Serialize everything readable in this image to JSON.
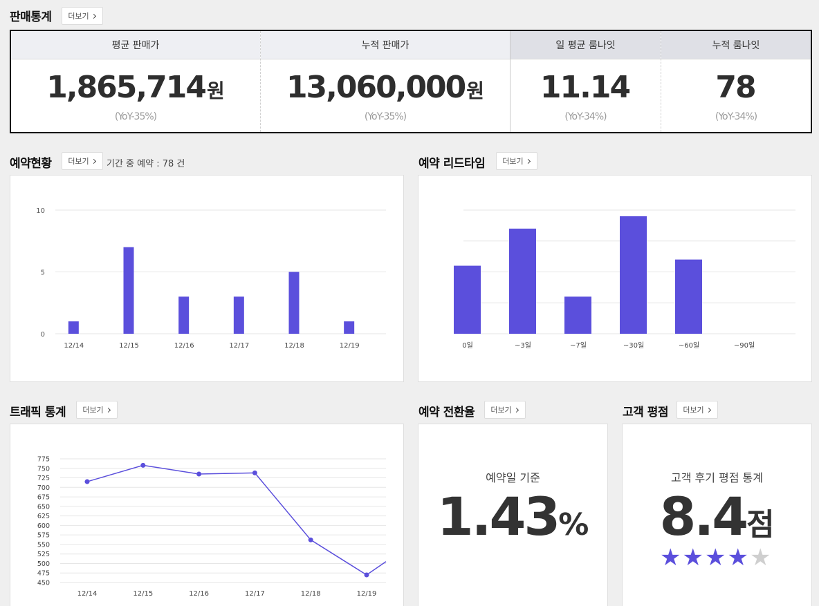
{
  "sales_stats": {
    "title": "판매통계",
    "more_label": "더보기",
    "columns": [
      {
        "label": "평균 판매가",
        "value": "1,865,714",
        "unit": "원",
        "yoy": "(YoY-35%)"
      },
      {
        "label": "누적 판매가",
        "value": "13,060,000",
        "unit": "원",
        "yoy": "(YoY-35%)"
      },
      {
        "label": "일 평균 룸나잇",
        "value": "11.14",
        "unit": "",
        "yoy": "(YoY-34%)"
      },
      {
        "label": "누적 룸나잇",
        "value": "78",
        "unit": "",
        "yoy": "(YoY-34%)"
      }
    ]
  },
  "reservation_status": {
    "title": "예약현황",
    "more_label": "더보기",
    "period_label": "기간 중 예약 :",
    "period_count": "78",
    "period_unit": "건"
  },
  "lead_time": {
    "title": "예약 리드타임",
    "more_label": "더보기"
  },
  "traffic": {
    "title": "트래픽 통계",
    "more_label": "더보기"
  },
  "conversion": {
    "title": "예약 전환율",
    "more_label": "더보기",
    "label": "예약일 기준",
    "value": "1.43",
    "unit": "%"
  },
  "rating": {
    "title": "고객 평점",
    "more_label": "더보기",
    "label": "고객 후기 평점 통계",
    "value": "8.4",
    "unit": "점",
    "stars_filled": 4,
    "stars_total": 5
  },
  "colors": {
    "accent": "#5b4fdc",
    "background": "#efefef"
  },
  "chart_data": [
    {
      "type": "bar",
      "categories": [
        "12/14",
        "12/15",
        "12/16",
        "12/17",
        "12/18",
        "12/19"
      ],
      "values": [
        1,
        7,
        3,
        3,
        5,
        1
      ],
      "ylim": [
        0,
        10
      ],
      "yticks": [
        "0",
        "5",
        "10"
      ],
      "grid": true
    },
    {
      "type": "bar",
      "categories": [
        "0일",
        "~3일",
        "~7일",
        "~30일",
        "~60일",
        "~90일"
      ],
      "values": [
        11,
        17,
        6,
        19,
        12,
        0
      ],
      "ylim": [
        0,
        20
      ],
      "grid": true
    },
    {
      "type": "line",
      "categories": [
        "12/14",
        "12/15",
        "12/16",
        "12/17",
        "12/18",
        "12/19"
      ],
      "values": [
        715,
        758,
        735,
        738,
        562,
        470
      ],
      "end_value": 505,
      "ylim": [
        450,
        775
      ],
      "yticks": [
        "450",
        "475",
        "500",
        "525",
        "550",
        "575",
        "600",
        "625",
        "650",
        "675",
        "700",
        "725",
        "750",
        "775"
      ],
      "grid": true
    }
  ]
}
